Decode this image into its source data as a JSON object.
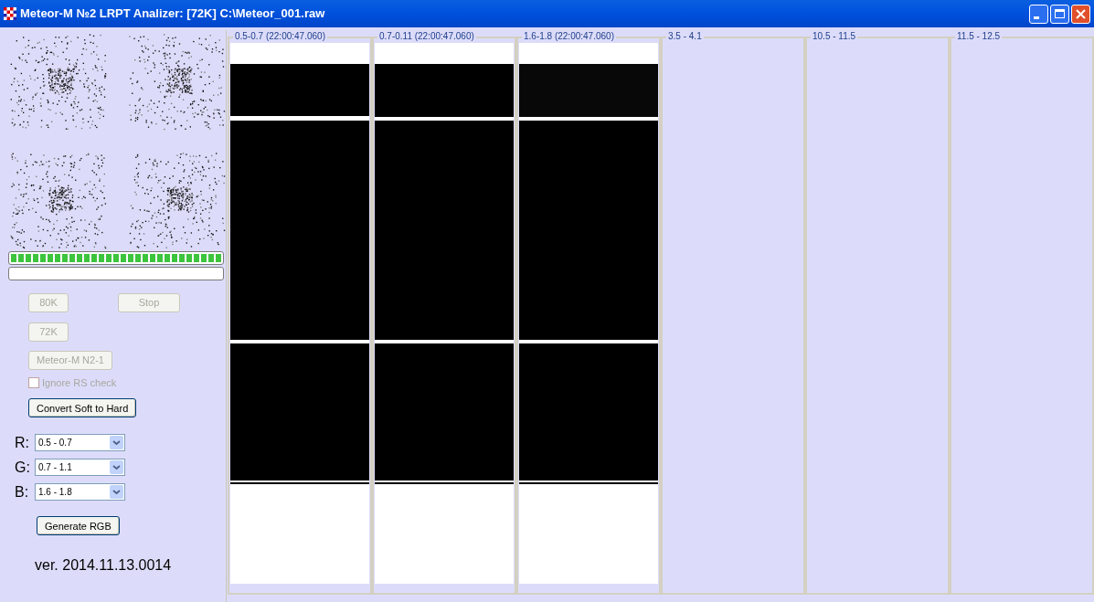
{
  "window": {
    "title": "Meteor-M №2 LRPT Analizer: [72K] C:\\Meteor_001.raw"
  },
  "left_panel": {
    "progress_bars": [
      {
        "level": 1
      },
      {
        "level": 0
      }
    ],
    "buttons": [
      {
        "label": "80K",
        "disabled": true
      },
      {
        "label": "Stop",
        "disabled": true
      },
      {
        "label": "72K",
        "disabled": true
      },
      {
        "label": "Meteor-M N2-1",
        "disabled": true
      }
    ],
    "checkbox": {
      "label": "Ignore RS check",
      "checked": false,
      "disabled": true
    },
    "convert_button": {
      "label": "Convert Soft to Hard",
      "disabled": false
    },
    "channels": [
      {
        "label": "R:",
        "value": "0.5 - 0.7"
      },
      {
        "label": "G:",
        "value": "0.7 - 1.1"
      },
      {
        "label": "B:",
        "value": "1.6 - 1.8"
      }
    ],
    "generate_button": {
      "label": "Generate RGB",
      "disabled": false
    },
    "version": "ver. 2014.11.13.0014"
  },
  "panels": [
    {
      "title": "0.5-0.7 (22:00:47.060)",
      "kind": "image"
    },
    {
      "title": "0.7-0.11 (22:00:47.060)",
      "kind": "image"
    },
    {
      "title": "1.6-1.8 (22:00:47.060)",
      "kind": "image"
    },
    {
      "title": "3.5 - 4.1",
      "kind": "empty"
    },
    {
      "title": "10.5 - 11.5",
      "kind": "empty"
    },
    {
      "title": "11.5 - 12.5",
      "kind": "empty"
    }
  ]
}
